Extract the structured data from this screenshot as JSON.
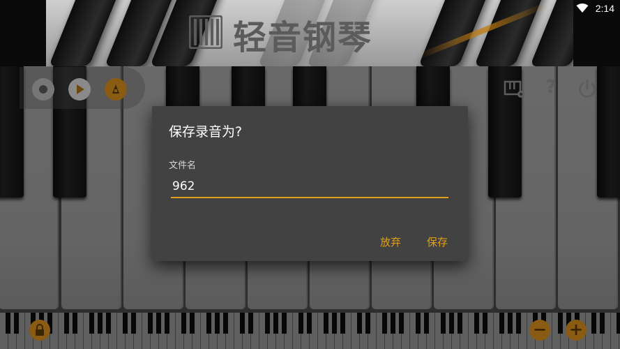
{
  "status_bar": {
    "time": "2:14",
    "wifi_icon": "wifi-icon"
  },
  "banner": {
    "app_title": "轻音钢琴",
    "logo_icon": "piano-logo-icon"
  },
  "toolbar": {
    "left_icons": [
      "record-icon",
      "play-icon",
      "metronome-icon"
    ],
    "right_icons": [
      "keyboard-settings-icon",
      "help-icon",
      "power-icon"
    ],
    "help_glyph": "?"
  },
  "dialog": {
    "title": "保存录音为?",
    "field_label": "文件名",
    "filename_value": "962",
    "discard_label": "放弃",
    "save_label": "保存"
  },
  "bottom_bar": {
    "lock_icon": "lock-icon",
    "zoom_out_glyph": "−",
    "zoom_in_glyph": "+"
  },
  "colors": {
    "accent": "#e2a018",
    "dialog_bg": "#424242",
    "dim_overlay": "rgba(0,0,0,0.56)"
  }
}
